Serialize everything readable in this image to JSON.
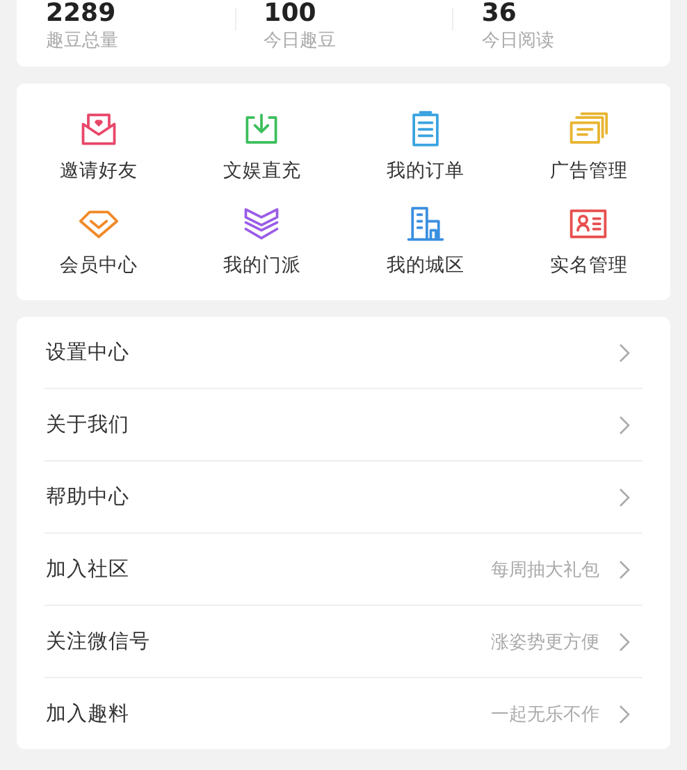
{
  "stats": [
    {
      "value": "2289",
      "label": "趣豆总量"
    },
    {
      "value": "100",
      "label": "今日趣豆"
    },
    {
      "value": "36",
      "label": "今日阅读"
    }
  ],
  "shortcuts": [
    {
      "label": "邀请好友",
      "kind": "invite",
      "color": "#e8476a"
    },
    {
      "label": "文娱直充",
      "kind": "download",
      "color": "#3cbf5c"
    },
    {
      "label": "我的订单",
      "kind": "clipboard",
      "color": "#3aa3e0"
    },
    {
      "label": "广告管理",
      "kind": "cards",
      "color": "#e8b430"
    },
    {
      "label": "会员中心",
      "kind": "diamond",
      "color": "#f08a28"
    },
    {
      "label": "我的门派",
      "kind": "layers",
      "color": "#9a5ce6"
    },
    {
      "label": "我的城区",
      "kind": "building",
      "color": "#3a8fe0"
    },
    {
      "label": "实名管理",
      "kind": "idcard",
      "color": "#e85050"
    }
  ],
  "menu": [
    {
      "label": "设置中心"
    },
    {
      "label": "关于我们"
    },
    {
      "label": "帮助中心"
    },
    {
      "label": "加入社区",
      "hint": "每周抽大礼包"
    },
    {
      "label": "关注微信号",
      "hint": "涨姿势更方便"
    },
    {
      "label": "加入趣料",
      "hint": "一起无乐不作"
    }
  ]
}
